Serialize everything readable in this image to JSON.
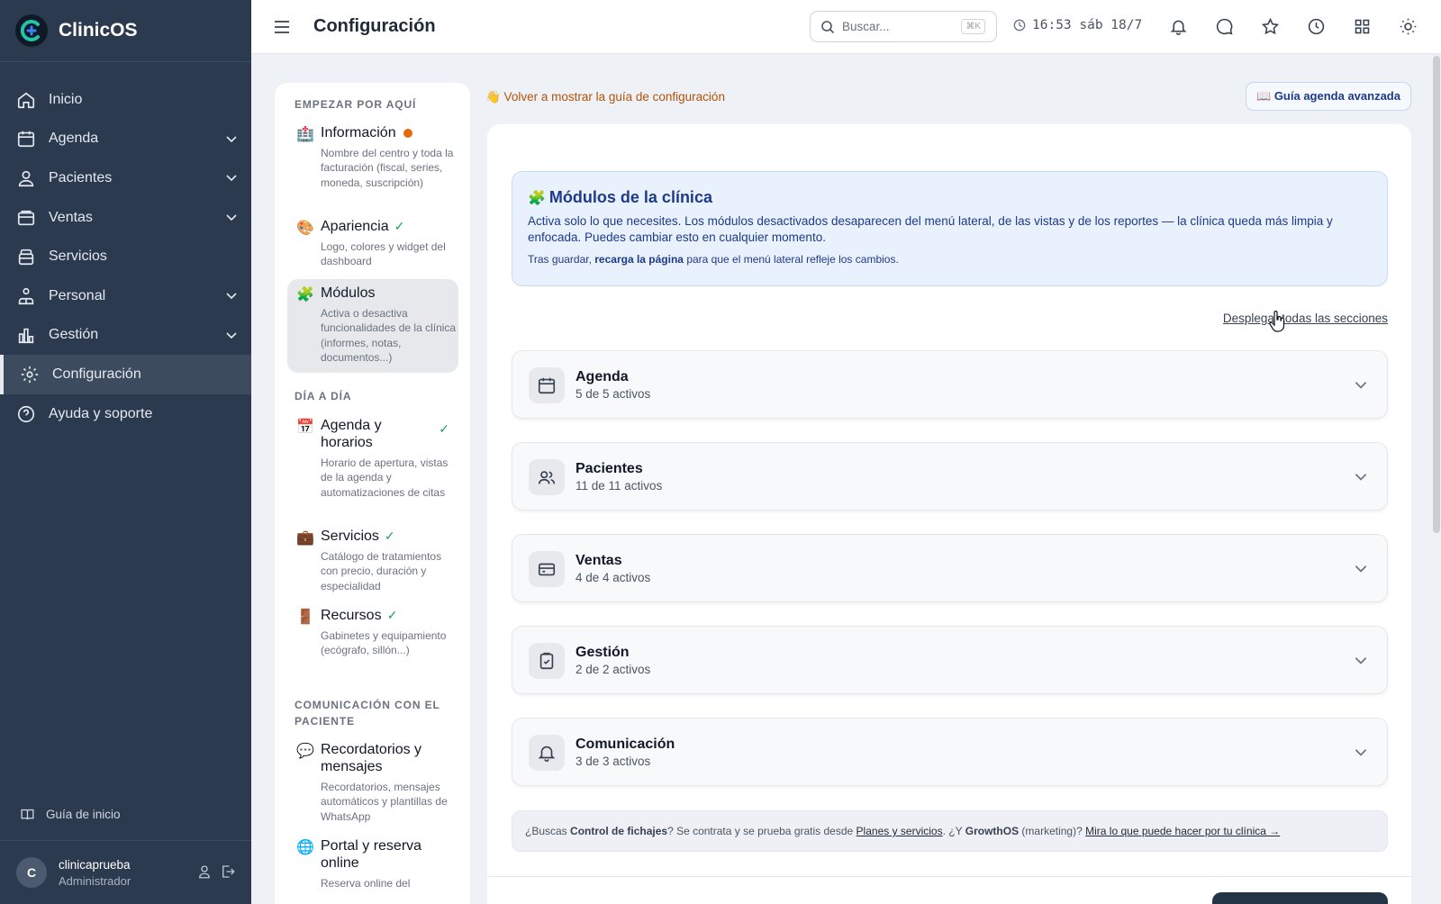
{
  "brand": {
    "name": "ClinicOS"
  },
  "sidebar": {
    "items": [
      {
        "label": "Inicio",
        "icon": "home-icon"
      },
      {
        "label": "Agenda",
        "icon": "calendar-icon"
      },
      {
        "label": "Pacientes",
        "icon": "users-icon"
      },
      {
        "label": "Ventas",
        "icon": "wallet-icon"
      },
      {
        "label": "Servicios",
        "icon": "box-icon"
      },
      {
        "label": "Personal",
        "icon": "team-icon"
      },
      {
        "label": "Gestión",
        "icon": "bar-chart-icon"
      },
      {
        "label": "Configuración",
        "icon": "gear-icon"
      },
      {
        "label": "Ayuda y soporte",
        "icon": "help-icon"
      }
    ],
    "guide_label": "Guía de inicio",
    "user": {
      "initial": "C",
      "name": "clinicaprueba",
      "role": "Administrador"
    }
  },
  "header": {
    "title": "Configuración",
    "search_placeholder": "Buscar...",
    "search_shortcut": "⌘K",
    "clock": "16:53 sáb 18/7"
  },
  "settings_nav": {
    "sections": [
      {
        "title": "EMPEZAR POR AQUÍ"
      },
      {
        "title": "DÍA A DÍA"
      },
      {
        "title": "COMUNICACIÓN CON EL PACIENTE"
      }
    ],
    "items": [
      {
        "emoji": "🏥",
        "title": "Información",
        "status": "pending",
        "desc": "Nombre del centro y toda la facturación (fiscal, series, moneda, suscripción)"
      },
      {
        "emoji": "🎨",
        "title": "Apariencia",
        "status": "✓",
        "desc": "Logo, colores y widget del dashboard"
      },
      {
        "emoji": "🧩",
        "title": "Módulos",
        "status": "",
        "desc": "Activa o desactiva funcionalidades de la clínica (informes, notas, documentos...)"
      },
      {
        "emoji": "📅",
        "title": "Agenda y horarios",
        "status": "✓",
        "desc": "Horario de apertura, vistas de la agenda y automatizaciones de citas"
      },
      {
        "emoji": "💼",
        "title": "Servicios",
        "status": "✓",
        "desc": "Catálogo de tratamientos con precio, duración y especialidad"
      },
      {
        "emoji": "🚪",
        "title": "Recursos",
        "status": "✓",
        "desc": "Gabinetes y equipamiento (ecógrafo, sillón...)"
      },
      {
        "emoji": "💬",
        "title": "Recordatorios y mensajes",
        "status": "",
        "desc": "Recordatorios, mensajes automáticos y plantillas de WhatsApp"
      },
      {
        "emoji": "🌐",
        "title": "Portal y reserva online",
        "status": "",
        "desc": "Reserva online del"
      }
    ]
  },
  "content": {
    "back_link": "👋 Volver a mostrar la guía de configuración",
    "guide_button": "📖 Guía agenda avanzada",
    "info": {
      "emoji": "🧩",
      "title": "Módulos de la clínica",
      "text": "Activa solo lo que necesites. Los módulos desactivados desaparecen del menú lateral, de las vistas y de los reportes — la clínica queda más limpia y enfocada. Puedes cambiar esto en cualquier momento.",
      "note_prefix": "Tras guardar,",
      "note_bold": "recarga la página",
      "note_suffix": "para que el menú lateral refleje los cambios."
    },
    "expand_all": "Desplegar todas las secciones",
    "modules": [
      {
        "name": "Agenda",
        "count": "5 de 5 activos",
        "icon": "calendar-icon"
      },
      {
        "name": "Pacientes",
        "count": "11 de 11 activos",
        "icon": "users-icon"
      },
      {
        "name": "Ventas",
        "count": "4 de 4 activos",
        "icon": "card-icon"
      },
      {
        "name": "Gestión",
        "count": "2 de 2 activos",
        "icon": "clipboard-icon"
      },
      {
        "name": "Comunicación",
        "count": "3 de 3 activos",
        "icon": "bell-icon"
      }
    ],
    "promo": {
      "t1": "¿Buscas",
      "b1": "Control de fichajes",
      "t2": "? Se contrata y se prueba gratis desde",
      "l1": "Planes y servicios",
      "t3": ". ¿Y",
      "b2": "GrowthOS",
      "t4": "(marketing)?",
      "l2": "Mira lo que puede hacer por tu clínica →"
    }
  },
  "colors": {
    "sidebar": "#2b3a4e",
    "accent": "#1e3a8a",
    "pending": "#e46b0d",
    "ok": "#22a35a"
  }
}
